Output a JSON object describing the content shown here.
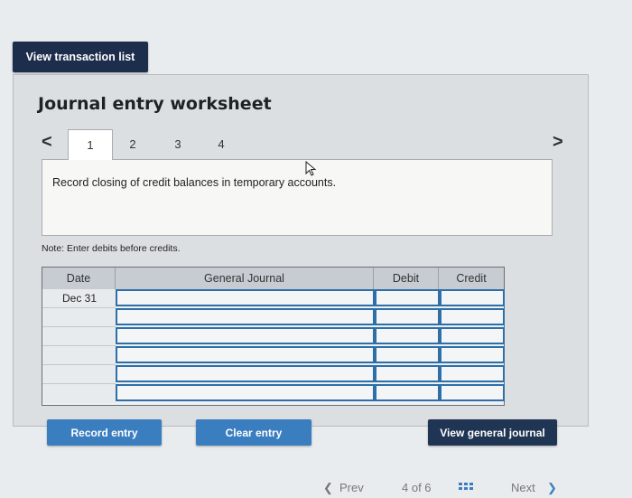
{
  "top_button": {
    "label": "View transaction list"
  },
  "worksheet": {
    "title": "Journal entry worksheet",
    "tabs": [
      "1",
      "2",
      "3",
      "4"
    ],
    "active_tab": "1",
    "prev_arrow": "<",
    "next_arrow": ">",
    "instruction": "Record closing of credit balances in temporary accounts.",
    "note": "Note: Enter debits before credits."
  },
  "journal": {
    "headers": {
      "date": "Date",
      "account": "General Journal",
      "debit": "Debit",
      "credit": "Credit"
    },
    "rows": [
      {
        "date": "Dec 31",
        "account": "",
        "debit": "",
        "credit": ""
      },
      {
        "date": "",
        "account": "",
        "debit": "",
        "credit": ""
      },
      {
        "date": "",
        "account": "",
        "debit": "",
        "credit": ""
      },
      {
        "date": "",
        "account": "",
        "debit": "",
        "credit": ""
      },
      {
        "date": "",
        "account": "",
        "debit": "",
        "credit": ""
      },
      {
        "date": "",
        "account": "",
        "debit": "",
        "credit": ""
      }
    ]
  },
  "actions": {
    "record": "Record entry",
    "clear": "Clear entry",
    "view_journal": "View general journal"
  },
  "pager": {
    "prev": "Prev",
    "position": "4 of 6",
    "next": "Next",
    "grid_icon": "grid-icon"
  },
  "colors": {
    "accent_dark": "#1d2e4c",
    "accent_blue": "#3b7ec0",
    "input_border": "#2e6fa8"
  }
}
